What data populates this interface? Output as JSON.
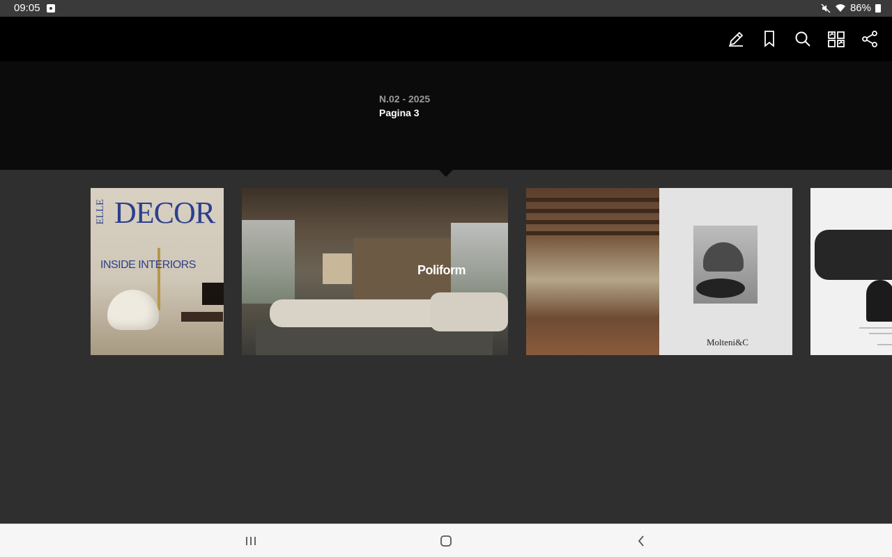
{
  "status_bar": {
    "time": "09:05",
    "battery": "86%",
    "icons": [
      "notification-icon",
      "mute-icon",
      "wifi-icon",
      "battery-icon"
    ]
  },
  "toolbar": {
    "icons": [
      "annotate-pen-icon",
      "bookmark-icon",
      "search-icon",
      "grid-view-icon",
      "share-icon"
    ]
  },
  "issue": {
    "number": "N.02 - 2025",
    "page": "Pagina 3"
  },
  "thumbnails": [
    {
      "id": "cover",
      "masthead": "DECOR",
      "brand": "ELLE",
      "headline": "INSIDE INTERIORS"
    },
    {
      "id": "poliform-spread",
      "logo": "Poliform"
    },
    {
      "id": "molteni-spread",
      "logo": "Molteni&C"
    },
    {
      "id": "next-spread"
    }
  ],
  "nav_bar": {
    "icons": [
      "recent-apps-icon",
      "home-icon",
      "back-icon"
    ]
  },
  "colors": {
    "toolbar_bg": "#000000",
    "panel_bg": "#0b0b0b",
    "strip_bg": "#2f2f2f",
    "status_bg": "#3a3a3a",
    "nav_bg": "#f6f6f6",
    "elle_blue": "#2d3f8c"
  }
}
